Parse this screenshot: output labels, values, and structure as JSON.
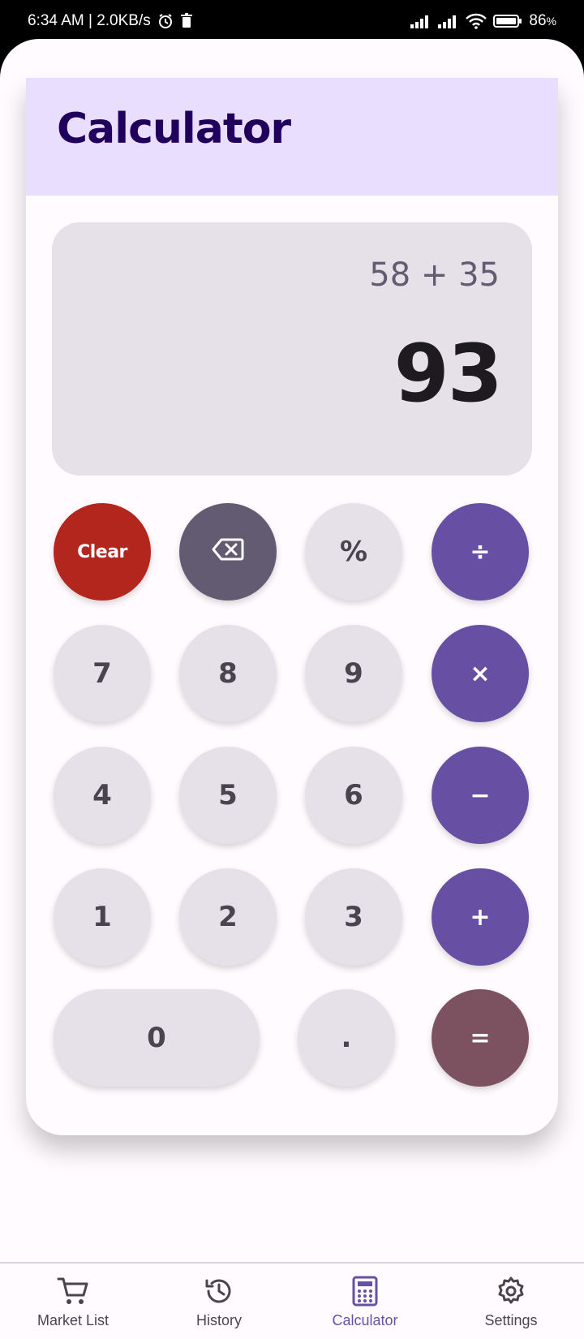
{
  "status_bar": {
    "time_speed": "6:34 AM | 2.0KB/s",
    "battery": "86",
    "battery_unit": "%"
  },
  "header": {
    "title": "Calculator"
  },
  "display": {
    "expression": "58 + 35",
    "result": "93"
  },
  "keypad": {
    "clear": "Clear",
    "percent": "%",
    "divide": "÷",
    "multiply": "×",
    "minus": "−",
    "plus": "+",
    "equals": "=",
    "decimal": ".",
    "digits": [
      "0",
      "1",
      "2",
      "3",
      "4",
      "5",
      "6",
      "7",
      "8",
      "9"
    ]
  },
  "nav": {
    "items": [
      {
        "label": "Market List",
        "icon": "cart-icon"
      },
      {
        "label": "History",
        "icon": "history-icon"
      },
      {
        "label": "Calculator",
        "icon": "calculator-icon",
        "active": true
      },
      {
        "label": "Settings",
        "icon": "gear-icon"
      }
    ]
  },
  "colors": {
    "primary": "#6750a4",
    "header_bg": "#eadeff",
    "title": "#21005d",
    "clear": "#b3261e",
    "equals": "#7d5260",
    "backspace": "#625b71",
    "key_bg": "#e6e0e9"
  }
}
